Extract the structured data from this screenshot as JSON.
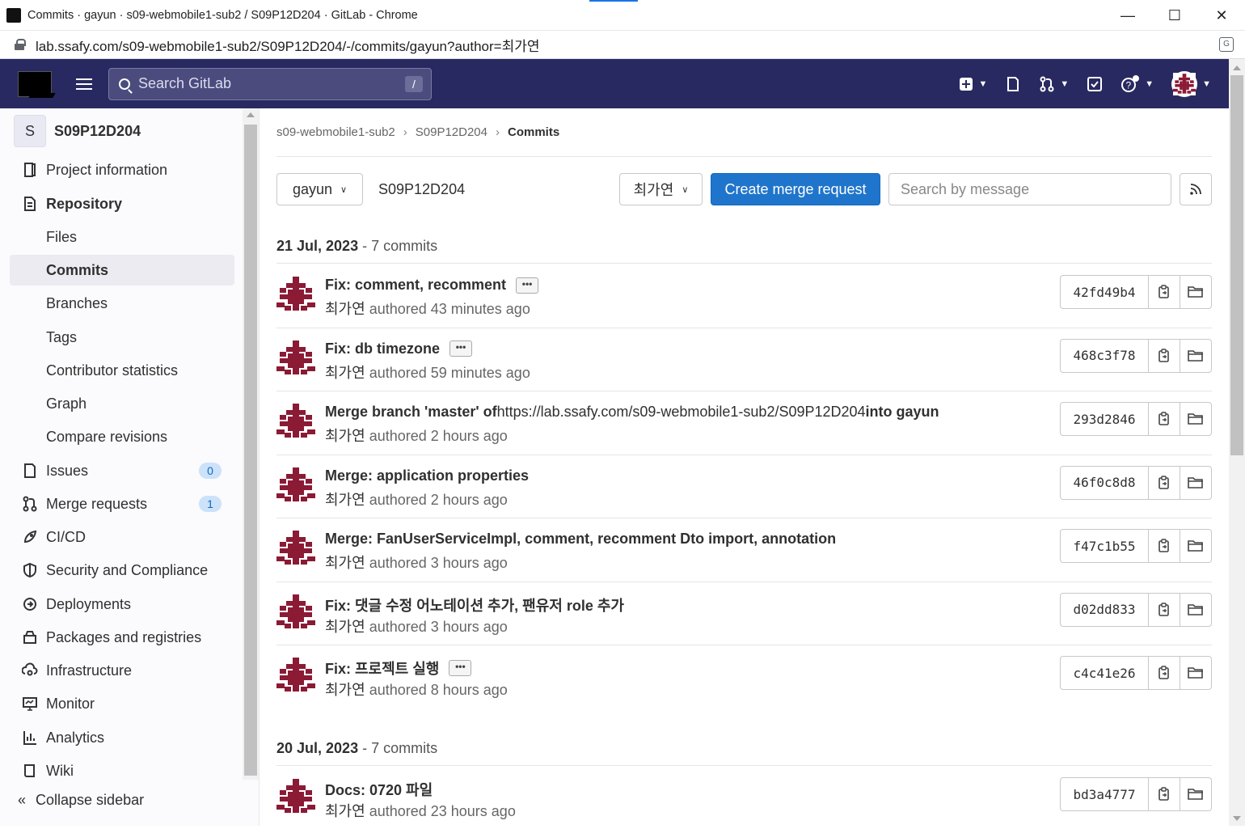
{
  "browser": {
    "tab_title": "Commits · gayun · s09-webmobile1-sub2 / S09P12D204 · GitLab - Chrome",
    "url": "lab.ssafy.com/s09-webmobile1-sub2/S09P12D204/-/commits/gayun?author=최가연",
    "minimize": "—",
    "maximize": "☐",
    "close": "✕"
  },
  "topnav": {
    "search_placeholder": "Search GitLab",
    "search_shortcut": "/"
  },
  "sidebar": {
    "project_initial": "S",
    "project_name": "S09P12D204",
    "items": [
      {
        "label": "Project information",
        "icon": "project-info-icon"
      },
      {
        "label": "Repository",
        "icon": "repository-icon"
      },
      {
        "label": "Files"
      },
      {
        "label": "Commits"
      },
      {
        "label": "Branches"
      },
      {
        "label": "Tags"
      },
      {
        "label": "Contributor statistics"
      },
      {
        "label": "Graph"
      },
      {
        "label": "Compare revisions"
      },
      {
        "label": "Issues",
        "icon": "issues-icon",
        "badge": "0"
      },
      {
        "label": "Merge requests",
        "icon": "merge-request-icon",
        "badge": "1"
      },
      {
        "label": "CI/CD",
        "icon": "rocket-icon"
      },
      {
        "label": "Security and Compliance",
        "icon": "shield-icon"
      },
      {
        "label": "Deployments",
        "icon": "deployments-icon"
      },
      {
        "label": "Packages and registries",
        "icon": "package-icon"
      },
      {
        "label": "Infrastructure",
        "icon": "cloud-gear-icon"
      },
      {
        "label": "Monitor",
        "icon": "monitor-icon"
      },
      {
        "label": "Analytics",
        "icon": "analytics-icon"
      },
      {
        "label": "Wiki",
        "icon": "book-icon"
      }
    ],
    "collapse_label": "Collapse sidebar"
  },
  "breadcrumbs": [
    "s09-webmobile1-sub2",
    "S09P12D204",
    "Commits"
  ],
  "toolbar": {
    "branch": "gayun",
    "project_path": "S09P12D204",
    "author": "최가연",
    "create_mr": "Create merge request",
    "search_placeholder": "Search by message"
  },
  "days": [
    {
      "date": "21 Jul, 2023",
      "count": " - 7 commits",
      "commits": [
        {
          "title": "Fix: comment, recomment",
          "has_more": true,
          "author": "최가연",
          "time": " authored 43 minutes ago",
          "sha": "42fd49b4"
        },
        {
          "title": "Fix: db timezone",
          "has_more": true,
          "author": "최가연",
          "time": " authored 59 minutes ago",
          "sha": "468c3f78"
        },
        {
          "title": "Merge branch 'master' of ",
          "link": "https://lab.ssafy.com/s09-webmobile1-sub2/S09P12D204",
          "title_end": " into gayun",
          "has_more": false,
          "author": "최가연",
          "time": " authored 2 hours ago",
          "sha": "293d2846"
        },
        {
          "title": "Merge: application properties",
          "has_more": false,
          "author": "최가연",
          "time": " authored 2 hours ago",
          "sha": "46f0c8d8"
        },
        {
          "title": "Merge: FanUserServiceImpl, comment, recomment Dto import, annotation",
          "has_more": false,
          "author": "최가연",
          "time": " authored 3 hours ago",
          "sha": "f47c1b55"
        },
        {
          "title": "Fix: 댓글 수정 어노테이션 추가, 팬유저 role 추가",
          "has_more": false,
          "author": "최가연",
          "time": " authored 3 hours ago",
          "sha": "d02dd833"
        },
        {
          "title": "Fix: 프로젝트 실행",
          "has_more": true,
          "author": "최가연",
          "time": " authored 8 hours ago",
          "sha": "c4c41e26"
        }
      ]
    },
    {
      "date": "20 Jul, 2023",
      "count": " - 7 commits",
      "commits": [
        {
          "title": "Docs: 0720 파일",
          "has_more": false,
          "author": "최가연",
          "time": " authored 23 hours ago",
          "sha": "bd3a4777"
        }
      ]
    }
  ],
  "colors": {
    "nav_bg": "#292961",
    "primary": "#1f75cb",
    "avatar": "#8b1a35"
  },
  "ellipsis": "•••"
}
